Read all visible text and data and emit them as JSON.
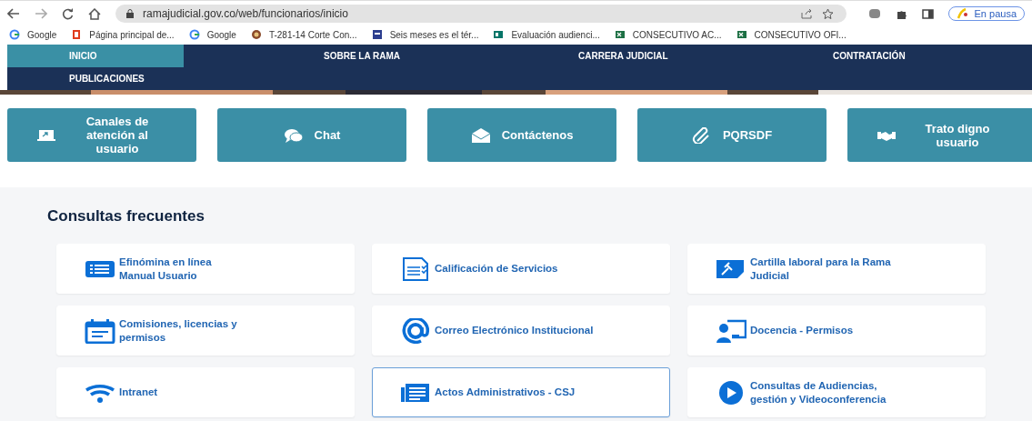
{
  "browser": {
    "url": "ramajudicial.gov.co/web/funcionarios/inicio",
    "profile_label": "En pausa",
    "bookmarks": [
      {
        "label": "Google",
        "kind": "google"
      },
      {
        "label": "Página principal de...",
        "kind": "office"
      },
      {
        "label": "Google",
        "kind": "google"
      },
      {
        "label": "T-281-14 Corte Con...",
        "kind": "seal"
      },
      {
        "label": "Seis meses es el tér...",
        "kind": "doc"
      },
      {
        "label": "Evaluación audienci...",
        "kind": "forms"
      },
      {
        "label": "CONSECUTIVO AC...",
        "kind": "excel"
      },
      {
        "label": "CONSECUTIVO OFI...",
        "kind": "excel"
      }
    ]
  },
  "nav": {
    "items": [
      {
        "label": "INICIO",
        "selected": true
      },
      {
        "label": "SOBRE LA RAMA",
        "selected": false
      },
      {
        "label": "CARRERA JUDICIAL",
        "selected": false
      },
      {
        "label": "CONTRATACIÓN",
        "selected": false
      },
      {
        "label": "PUBLICACIONES",
        "selected": false
      }
    ]
  },
  "quick_links": [
    {
      "label": "Canales de atención al usuario",
      "kind": "laptop"
    },
    {
      "label": "Chat",
      "kind": "chat"
    },
    {
      "label": "Contáctenos",
      "kind": "envelope"
    },
    {
      "label": "PQRSDF",
      "kind": "paperclip"
    },
    {
      "label": "Trato digno usuario",
      "kind": "handshake"
    }
  ],
  "frequent": {
    "title": "Consultas frecuentes",
    "cards": [
      {
        "lines": [
          "Efinómina en línea",
          "Manual Usuario"
        ],
        "kind": "list",
        "selected": false
      },
      {
        "lines": [
          "Calificación de Servicios"
        ],
        "kind": "document",
        "selected": false
      },
      {
        "lines": [
          "Cartilla laboral para la Rama",
          "Judicial"
        ],
        "kind": "gavel",
        "selected": false
      },
      {
        "lines": [
          "Comisiones, licencias y",
          "permisos"
        ],
        "kind": "calendar",
        "selected": false
      },
      {
        "lines": [
          "Correo Electrónico Institucional"
        ],
        "kind": "at",
        "selected": false
      },
      {
        "lines": [
          "Docencia - Permisos"
        ],
        "kind": "teacher",
        "selected": false
      },
      {
        "lines": [
          "Intranet"
        ],
        "kind": "wifi",
        "selected": false
      },
      {
        "lines": [
          "Actos Administrativos - CSJ"
        ],
        "kind": "newspaper",
        "selected": true
      },
      {
        "lines": [
          "Consultas de Audiencias,",
          "gestión y Videoconferencia"
        ],
        "kind": "play",
        "selected": false
      }
    ]
  }
}
